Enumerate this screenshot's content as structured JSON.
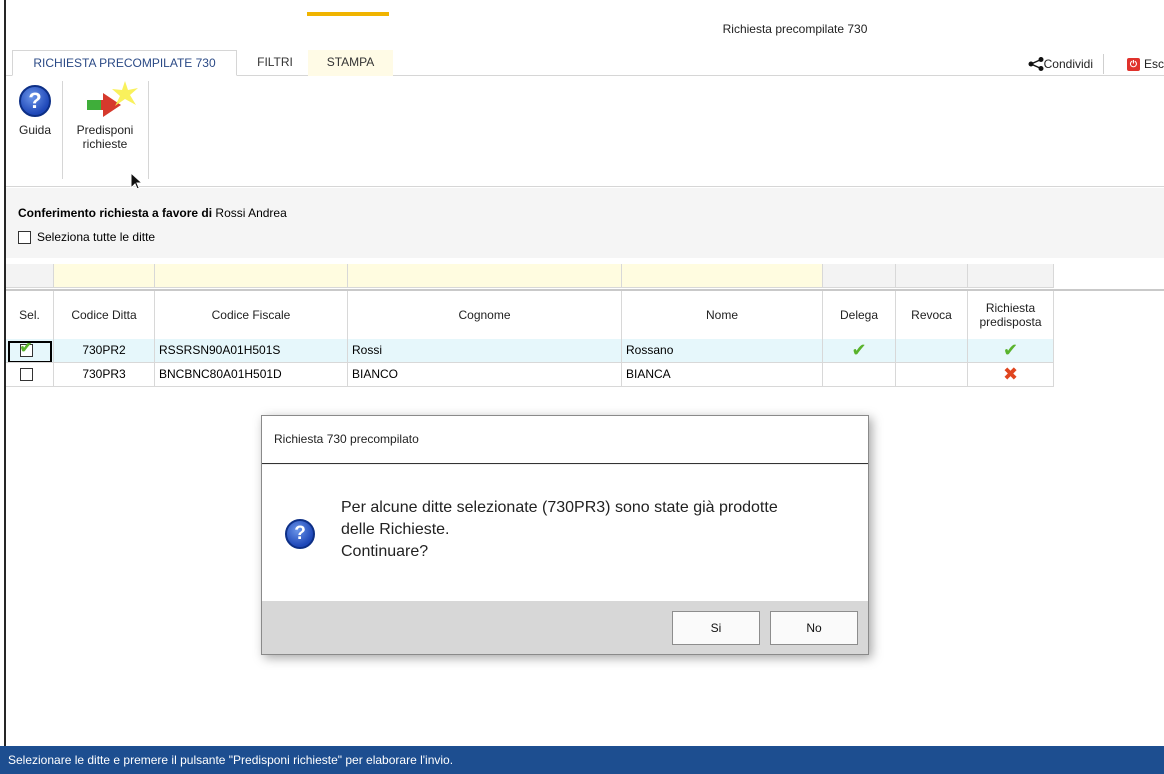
{
  "window": {
    "title": "Richiesta precompilate 730"
  },
  "ribbon": {
    "tabs": [
      {
        "label": "RICHIESTA PRECOMPILATE 730",
        "active": true
      },
      {
        "label": "FILTRI",
        "active": false
      },
      {
        "label": "STAMPA",
        "active": false
      }
    ],
    "share_label": "Condividi",
    "exit_label": "Esc",
    "buttons": {
      "guida": "Guida",
      "predisponi_line1": "Predisponi",
      "predisponi_line2": "richieste"
    }
  },
  "panel": {
    "conf_bold": "Conferimento richiesta a favore di",
    "conf_name": "Rossi Andrea",
    "select_all_label": "Seleziona tutte le ditte",
    "select_all_checked": false
  },
  "table": {
    "columns": [
      "Sel.",
      "Codice Ditta",
      "Codice Fiscale",
      "Cognome",
      "Nome",
      "Delega",
      "Revoca",
      "Richiesta predisposta"
    ],
    "rows": [
      {
        "sel": true,
        "codice_ditta": "730PR2",
        "codice_fiscale": "RSSRSN90A01H501S",
        "cognome": "Rossi",
        "nome": "Rossano",
        "delega": "check",
        "revoca": "",
        "richiesta": "check"
      },
      {
        "sel": false,
        "codice_ditta": "730PR3",
        "codice_fiscale": "BNCBNC80A01H501D",
        "cognome": "BIANCO",
        "nome": "BIANCA",
        "delega": "",
        "revoca": "",
        "richiesta": "cross"
      }
    ]
  },
  "dialog": {
    "title": "Richiesta 730 precompilato",
    "line1": "Per alcune ditte selezionate (730PR3) sono state già prodotte",
    "line2": "delle Richieste.",
    "line3": "Continuare?",
    "yes_label": "Si",
    "no_label": "No",
    "icon": "question-icon"
  },
  "statusbar": {
    "text": "Selezionare le ditte e premere il pulsante \"Predisponi richieste\" per elaborare l'invio."
  },
  "colors": {
    "status_bg": "#1d4e90",
    "check": "#59b32c",
    "cross": "#e0451f",
    "accent": "#f0b400"
  }
}
